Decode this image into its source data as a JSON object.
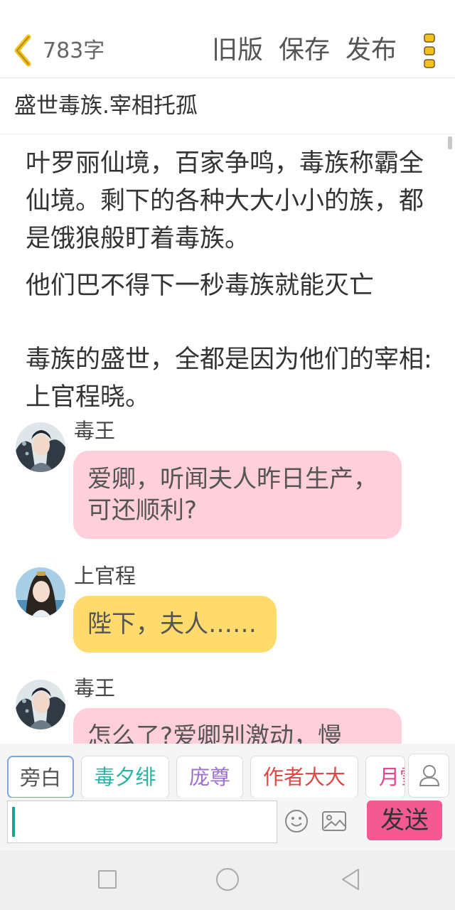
{
  "header": {
    "word_count": "783字",
    "old_version": "旧版",
    "save": "保存",
    "publish": "发布"
  },
  "title": "盛世毒族.宰相托孤",
  "narration": [
    "叶罗丽仙境，百家争鸣，毒族称霸全仙境。剩下的各种大大小小的族，都是饿狼般盯着毒族。",
    "他们巴不得下一秒毒族就能灭亡",
    "毒族的盛世，全都是因为他们的宰相:上官程晓。"
  ],
  "messages": [
    {
      "name": "毒王",
      "text": "爱卿，听闻夫人昨日生产，可还顺利?",
      "color": "#ffd0dc"
    },
    {
      "name": "上官程",
      "text": "陛下，夫人……",
      "color": "#ffdb6e"
    },
    {
      "name": "毒王",
      "text": "怎么了?爱卿别激动，慢",
      "color": "#ffd0dc"
    }
  ],
  "chips": [
    {
      "label": "旁白",
      "color": "#555555"
    },
    {
      "label": "毒夕绯",
      "color": "#2bb3a3"
    },
    {
      "label": "庞尊",
      "color": "#a070d0"
    },
    {
      "label": "作者大大",
      "color": "#e04848"
    },
    {
      "label": "月雪",
      "color": "#e04890"
    }
  ],
  "input": {
    "value": "",
    "send_label": "发送"
  },
  "icons": {
    "back": "chevron-left-icon",
    "more": "more-vertical-icon",
    "user": "user-icon",
    "emoji": "emoji-icon",
    "image": "image-icon"
  },
  "accent": "#f4c01e"
}
